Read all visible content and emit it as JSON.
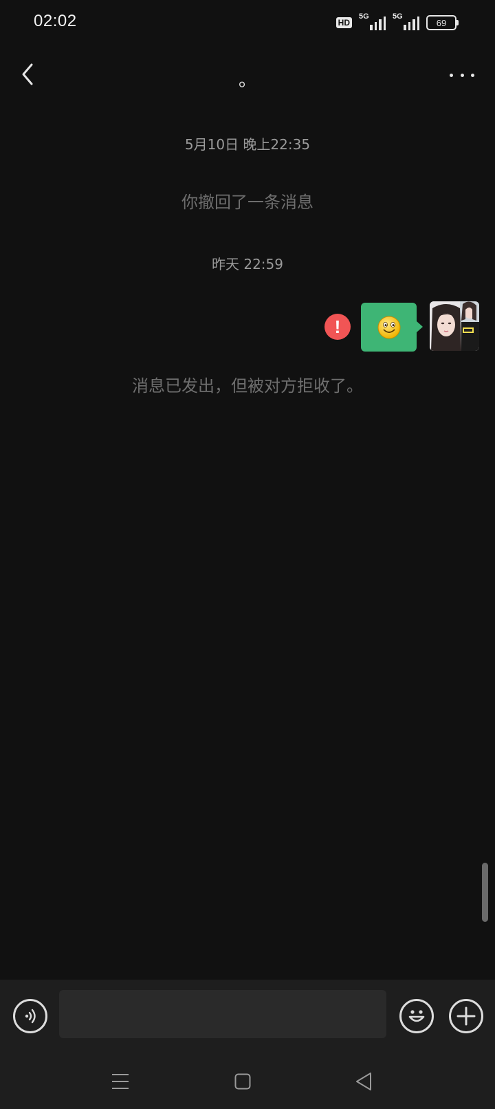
{
  "status_bar": {
    "time": "02:02",
    "hd_label": "HD",
    "signal1_label": "5G",
    "signal2_label": "5G",
    "battery": "69"
  },
  "header": {
    "title": "。",
    "back_icon": "chevron-left-icon",
    "more_icon": "more-dots-icon"
  },
  "chat": {
    "timestamp_1": "5月10日 晚上22:35",
    "recall_notice": "你撤回了一条消息",
    "timestamp_2": "昨天 22:59",
    "message_emoji": "🙂",
    "error_mark": "!",
    "rejected_notice": "消息已发出，但被对方拒收了。"
  },
  "input_bar": {
    "text_value": "",
    "placeholder": "",
    "voice_icon": "voice-icon",
    "emoji_icon": "emoji-icon",
    "plus_icon": "plus-icon"
  },
  "nav_bar": {
    "menu_icon": "menu-icon",
    "home_icon": "home-icon",
    "back_icon": "back-triangle-icon"
  },
  "colors": {
    "background": "#111111",
    "bubble_green": "#3eb575",
    "error_red": "#f15555",
    "input_bar": "#1e1e1e"
  }
}
